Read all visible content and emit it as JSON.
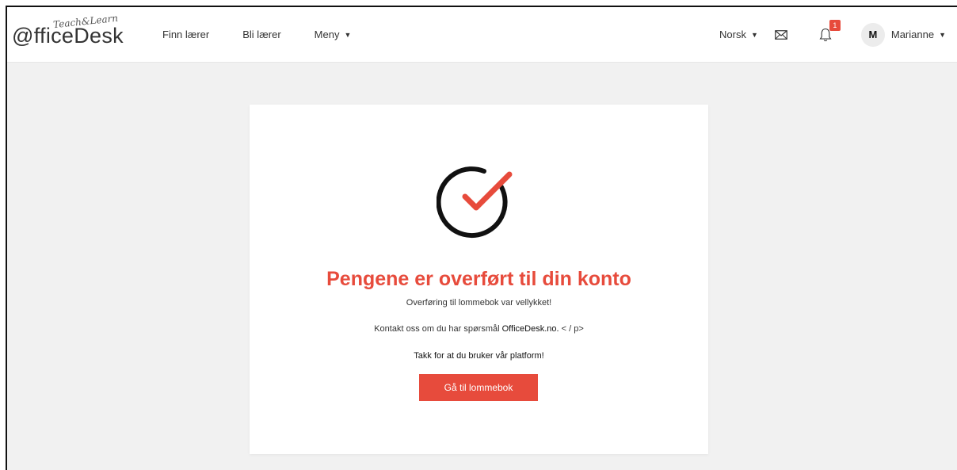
{
  "header": {
    "logo": {
      "main": "@fficeDesk",
      "tagline": "Teach&Learn"
    },
    "nav": [
      {
        "label": "Finn lærer"
      },
      {
        "label": "Bli lærer"
      },
      {
        "label": "Meny"
      }
    ],
    "language": "Norsk",
    "notifications_count": "1",
    "user": {
      "initial": "M",
      "name": "Marianne"
    }
  },
  "card": {
    "title": "Pengene er overført til din konto",
    "subtitle": "Overføring til lommebok var vellykket!",
    "contact_prefix": "Kontakt oss om du har spørsmål ",
    "contact_brand": "OfficeDesk.no.",
    "contact_suffix": " < / p>",
    "thanks": "Takk for at du bruker vår platform!",
    "button_label": "Gå til lommebok"
  },
  "colors": {
    "accent": "#e74b3c",
    "check_ring": "#111111",
    "background": "#f1f1f1"
  },
  "icons": {
    "mail": "envelope-icon",
    "bell": "bell-icon",
    "success": "checkmark-circle-icon"
  }
}
